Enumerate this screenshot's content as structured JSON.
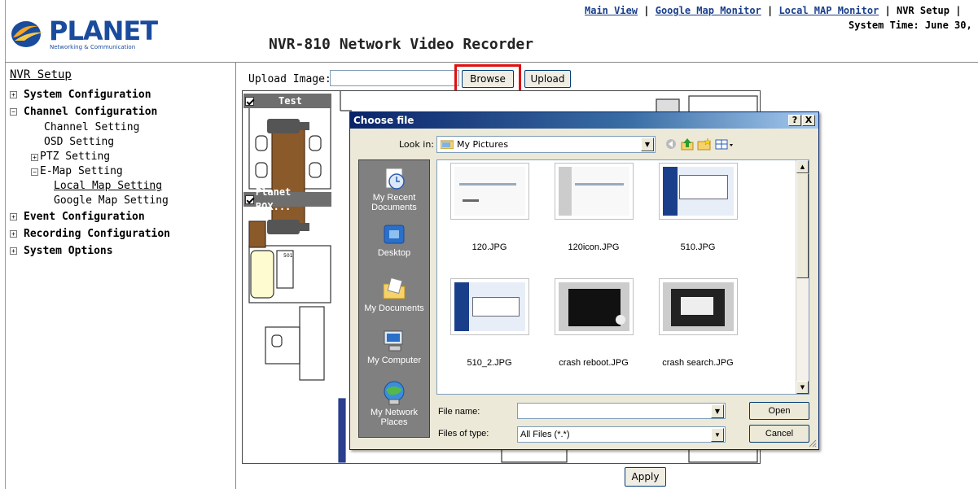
{
  "header": {
    "logo_text": "PLANET",
    "logo_sub": "Networking & Communication",
    "page_title": "NVR-810 Network Video Recorder",
    "links": [
      "Main View",
      "Google Map Monitor",
      "Local MAP Monitor"
    ],
    "current": "NVR Setup",
    "separator": " | ",
    "system_time": "System Time: June 30,"
  },
  "sidebar": {
    "title": "NVR Setup",
    "sections": {
      "system_configuration": "System Configuration",
      "channel_configuration": "Channel Configuration",
      "event_configuration": "Event Configuration",
      "recording_configuration": "Recording Configuration",
      "system_options": "System Options"
    },
    "channel_items": {
      "channel_setting": "Channel Setting",
      "osd_setting": "OSD Setting",
      "ptz_setting": "PTZ Setting",
      "emap_setting": "E-Map Setting",
      "local_map_setting": "Local Map Setting",
      "google_map_setting": "Google Map Setting"
    },
    "expand_symbol": "+",
    "collapse_symbol": "−"
  },
  "upload": {
    "label": "Upload Image:",
    "value": "",
    "browse_label": "Browse",
    "upload_label": "Upload"
  },
  "map": {
    "cameras": [
      "Test",
      "Planet BOX..."
    ],
    "room_label": "501",
    "apply_label": "Apply"
  },
  "dialog": {
    "title": "Choose file",
    "help_label": "?",
    "close_label": "X",
    "look_in_label": "Look in:",
    "look_in_value": "My Pictures",
    "places": [
      "My Recent Documents",
      "Desktop",
      "My Documents",
      "My Computer",
      "My Network Places"
    ],
    "files": [
      "120.JPG",
      "120icon.JPG",
      "510.JPG",
      "510_2.JPG",
      "crash reboot.JPG",
      "crash search.JPG"
    ],
    "file_name_label": "File name:",
    "file_name_value": "",
    "file_type_label": "Files of type:",
    "file_type_value": "All Files (*.*)",
    "open_label": "Open",
    "cancel_label": "Cancel"
  },
  "colors": {
    "link": "#1a3f8a",
    "highlight": "#e01010",
    "dialog_title": "#0a246a",
    "dialog_body": "#ece9d8",
    "places_bar": "#808080"
  }
}
